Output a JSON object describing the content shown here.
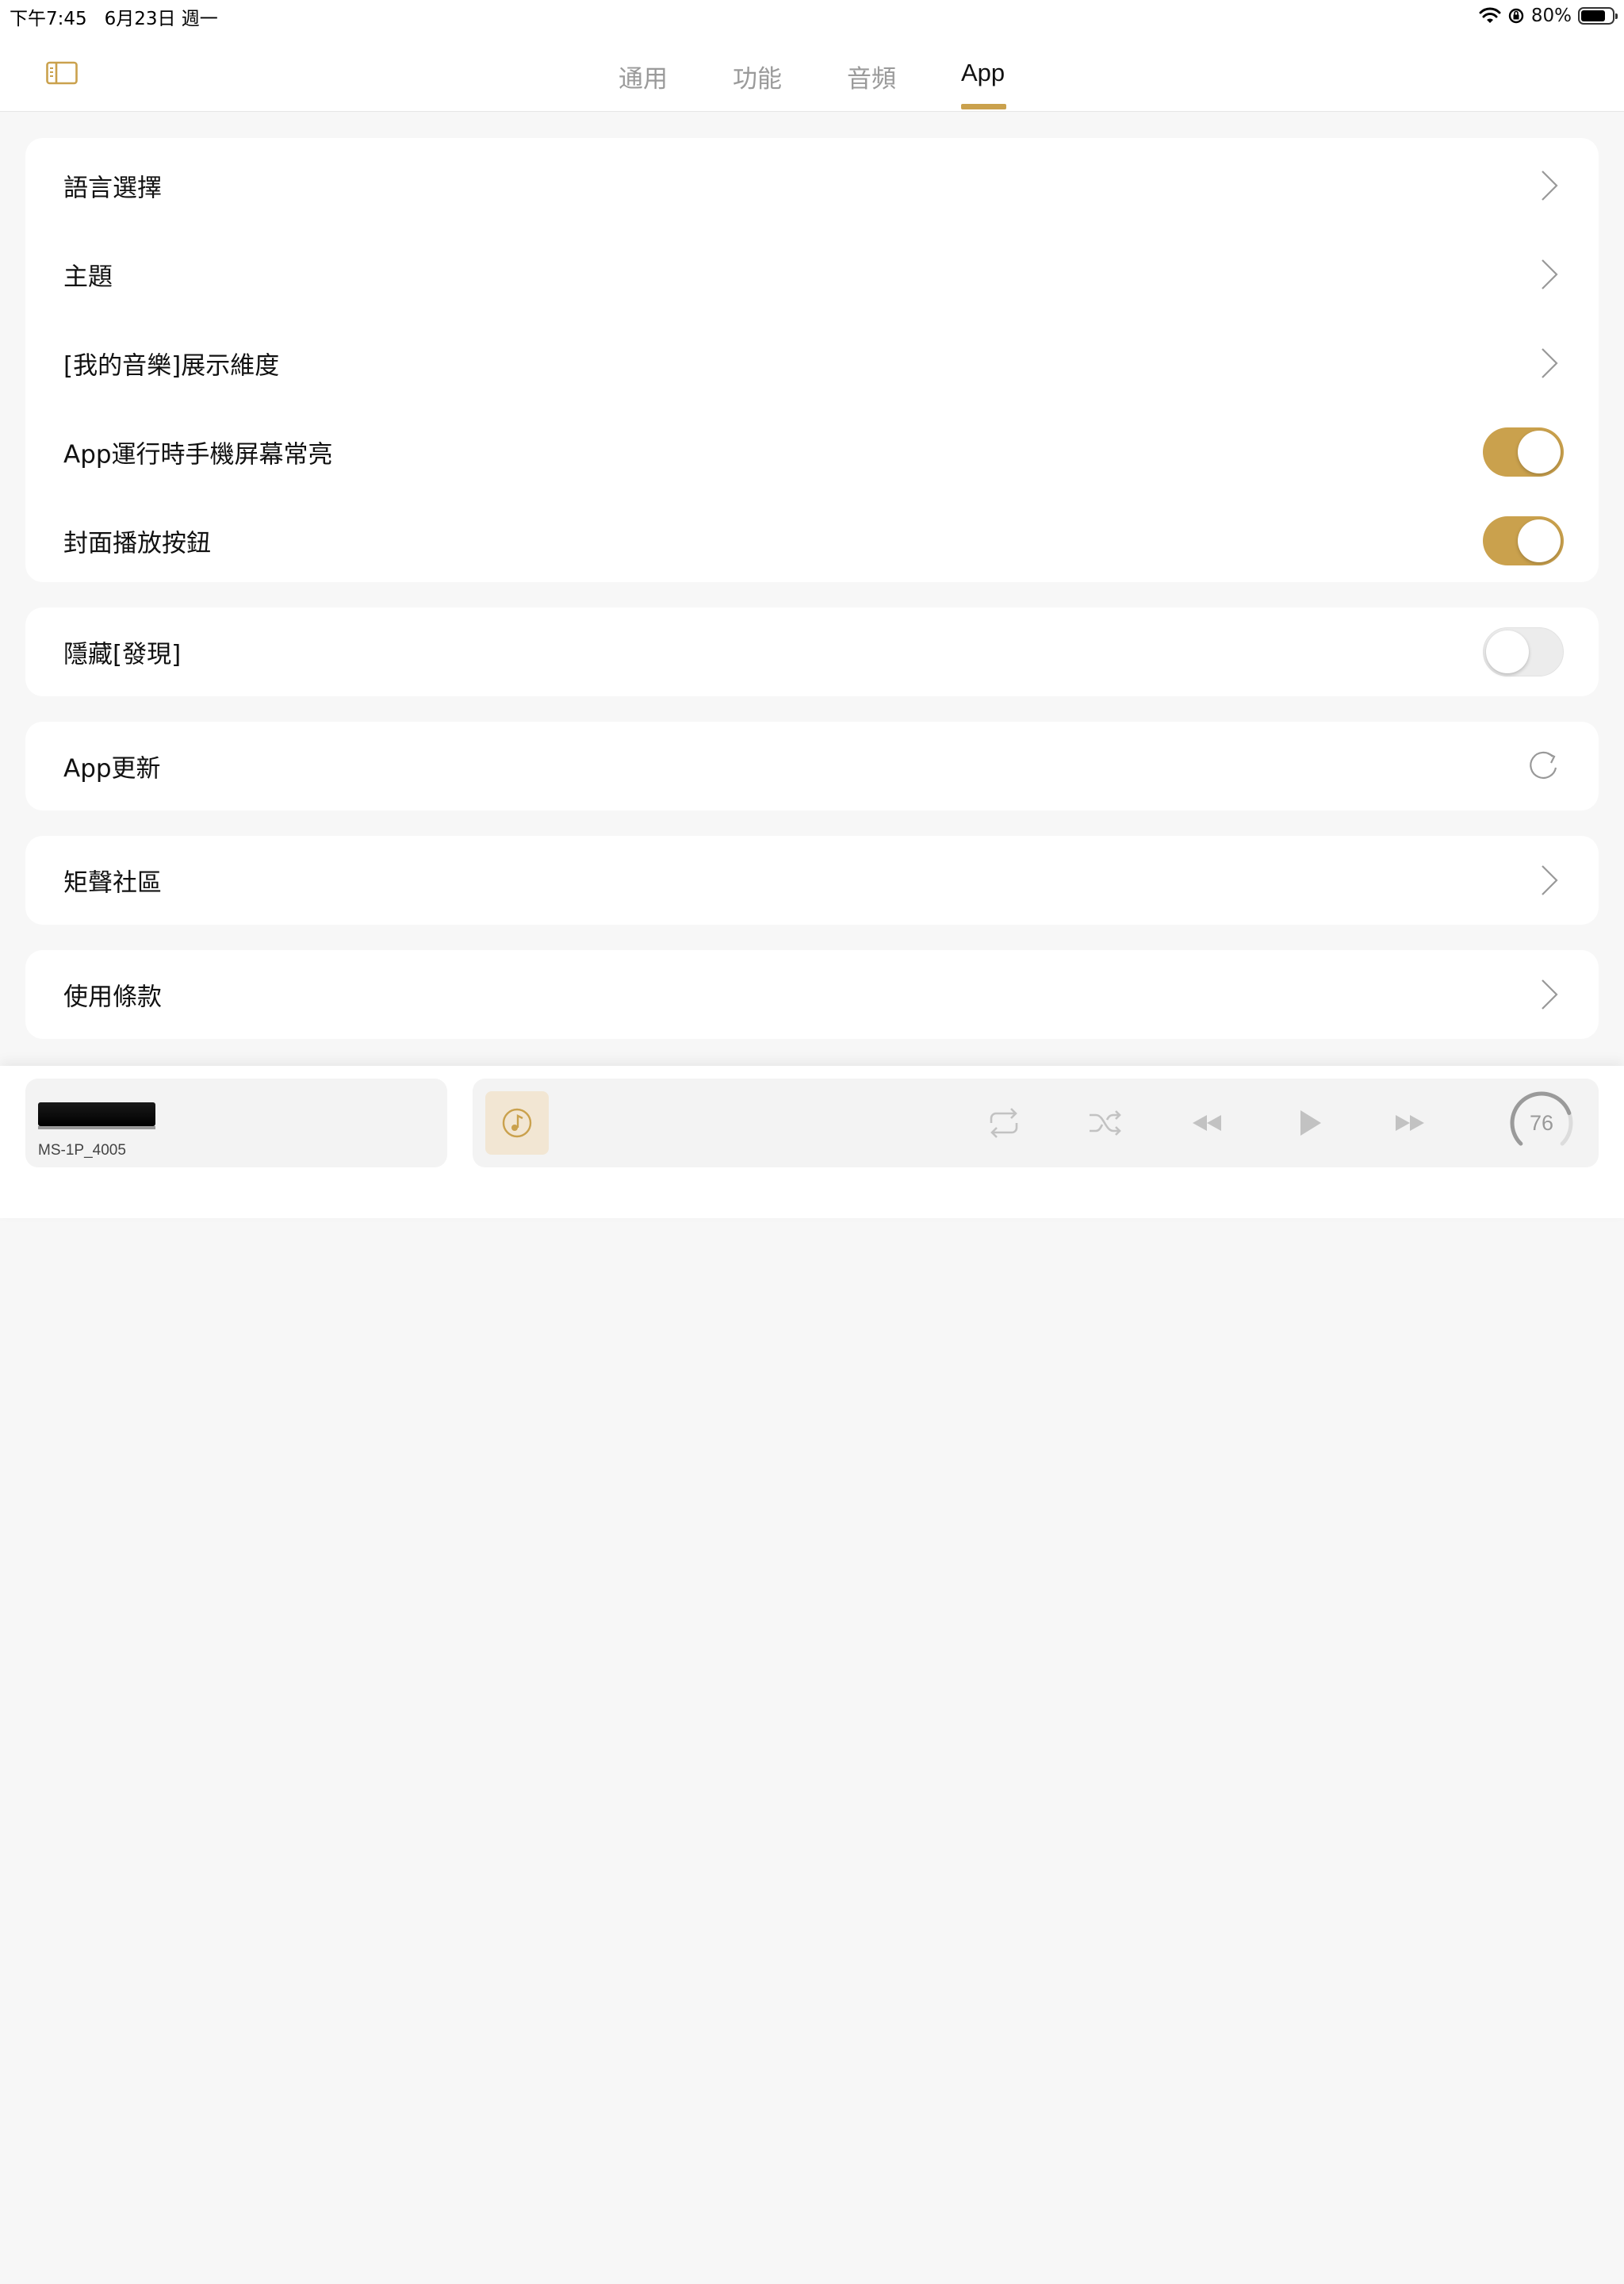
{
  "status_bar": {
    "time_date": "下午7:45   6月23日 週一",
    "battery_percent": "80%",
    "battery_level": 0.8
  },
  "header": {
    "sidebar_toggle_icon": "sidebar-icon",
    "tabs": [
      {
        "label": "通用",
        "active": false
      },
      {
        "label": "功能",
        "active": false
      },
      {
        "label": "音頻",
        "active": false
      },
      {
        "label": "App",
        "active": true
      }
    ]
  },
  "settings": {
    "group1": [
      {
        "label": "語言選擇",
        "control": "chevron"
      },
      {
        "label": "主題",
        "control": "chevron"
      },
      {
        "label": "[我的音樂]展示維度",
        "control": "chevron"
      },
      {
        "label": "App運行時手機屏幕常亮",
        "control": "toggle",
        "on": true
      },
      {
        "label": "封面播放按鈕",
        "control": "toggle",
        "on": true
      }
    ],
    "hide_discover": {
      "label": "隱藏[發現]",
      "control": "toggle",
      "on": false
    },
    "app_update": {
      "label": "App更新",
      "control": "refresh-icon"
    },
    "community": {
      "label": "矩聲社區",
      "control": "chevron"
    },
    "terms": {
      "label": "使用條款",
      "control": "chevron"
    }
  },
  "player": {
    "device_name": "MS-1P_4005",
    "volume": "76",
    "volume_level": 0.76,
    "icons": [
      "music-note-icon",
      "repeat-icon",
      "shuffle-icon",
      "previous-icon",
      "play-icon",
      "next-icon"
    ]
  },
  "colors": {
    "accent": "#caa14d",
    "background": "#f7f7f7",
    "card": "#ffffff",
    "inactive_tab": "#9a9a9a"
  }
}
